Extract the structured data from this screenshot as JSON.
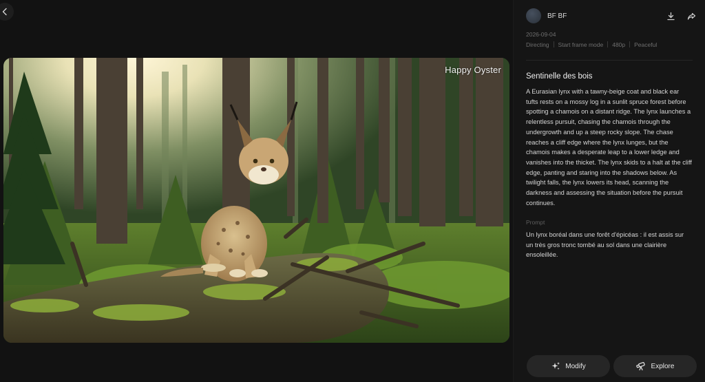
{
  "nav": {
    "back_icon": "chevron-left-icon"
  },
  "media": {
    "watermark": "Happy Oyster"
  },
  "sidebar": {
    "username": "BF BF",
    "date": "2026-09-04",
    "meta": [
      "Directing",
      "Start frame mode",
      "480p",
      "Peaceful"
    ],
    "title": "Sentinelle des bois",
    "description": "A Eurasian lynx with a tawny-beige coat and black ear tufts rests on a mossy log in a sunlit spruce forest before spotting a chamois on a distant ridge. The lynx launches a relentless pursuit, chasing the chamois through the undergrowth and up a steep rocky slope. The chase reaches a cliff edge where the lynx lunges, but the chamois makes a desperate leap to a lower ledge and vanishes into the thicket. The lynx skids to a halt at the cliff edge, panting and staring into the shadows below. As twilight falls, the lynx lowers its head, scanning the darkness and assessing the situation before the pursuit continues.",
    "prompt_label": "Prompt",
    "prompt": "Un lynx boréal dans une forêt d'épicéas : il est assis sur un très gros tronc tombé au sol dans une clairière ensoleillée.",
    "icons": {
      "download": "download-icon",
      "share": "share-icon"
    }
  },
  "actions": {
    "modify_label": "Modify",
    "explore_label": "Explore",
    "modify_icon": "sparkle-icon",
    "explore_icon": "telescope-icon"
  }
}
